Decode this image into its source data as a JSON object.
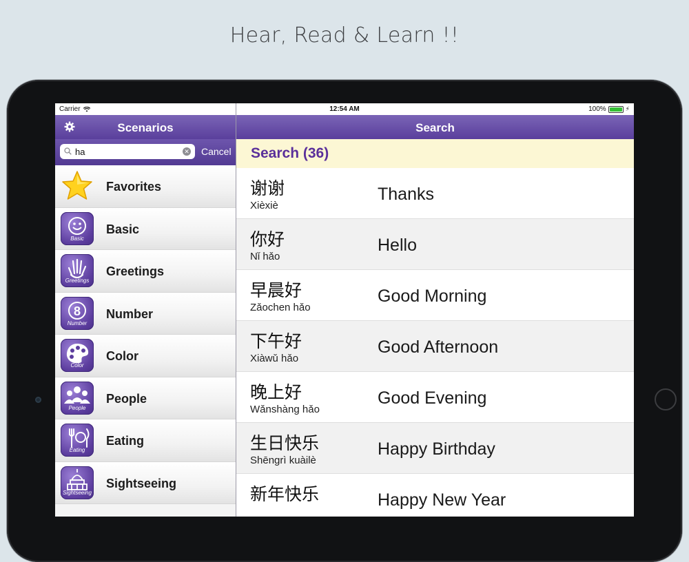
{
  "headline": "Hear, Read & Learn !!",
  "status_bar": {
    "carrier": "Carrier",
    "time": "12:54 AM",
    "battery": "100%"
  },
  "left_nav": {
    "title": "Scenarios",
    "settings_icon": "gear-icon"
  },
  "search": {
    "value": "ha",
    "cancel_label": "Cancel"
  },
  "scenarios": [
    {
      "label": "Favorites",
      "icon": "star-icon",
      "icon_sub": ""
    },
    {
      "label": "Basic",
      "icon": "smiley-icon",
      "icon_sub": "Basic"
    },
    {
      "label": "Greetings",
      "icon": "hand-icon",
      "icon_sub": "Greetings"
    },
    {
      "label": "Number",
      "icon": "number-icon",
      "icon_sub": "Number"
    },
    {
      "label": "Color",
      "icon": "palette-icon",
      "icon_sub": "Color"
    },
    {
      "label": "People",
      "icon": "people-icon",
      "icon_sub": "People"
    },
    {
      "label": "Eating",
      "icon": "utensils-icon",
      "icon_sub": "Eating"
    },
    {
      "label": "Sightseeing",
      "icon": "landmark-icon",
      "icon_sub": "Sightseeing"
    }
  ],
  "right_nav": {
    "title": "Search"
  },
  "results_header": "Search (36)",
  "results": [
    {
      "hanzi": "谢谢",
      "pinyin": "Xièxiè",
      "english": "Thanks"
    },
    {
      "hanzi": "你好",
      "pinyin": "Nǐ hǎo",
      "english": "Hello"
    },
    {
      "hanzi": "早晨好",
      "pinyin": "Zǎochen hǎo",
      "english": "Good Morning"
    },
    {
      "hanzi": "下午好",
      "pinyin": "Xiàwǔ hǎo",
      "english": "Good Afternoon"
    },
    {
      "hanzi": "晚上好",
      "pinyin": "Wǎnshàng hǎo",
      "english": "Good Evening"
    },
    {
      "hanzi": "生日快乐",
      "pinyin": "Shēngrì kuàilè",
      "english": "Happy Birthday"
    },
    {
      "hanzi": "新年快乐",
      "pinyin": "",
      "english": "Happy New Year"
    }
  ],
  "colors": {
    "nav_purple": "#6a51ab",
    "header_yellow": "#fcf7d4",
    "header_text": "#5a2f9a",
    "background": "#dce5ea"
  }
}
